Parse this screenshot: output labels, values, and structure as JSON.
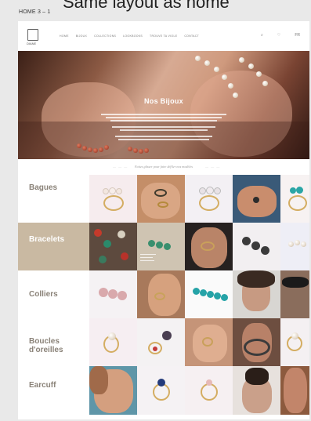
{
  "top_note": "Same layout as home",
  "frame_label": "HOME 3 – 1",
  "brand": {
    "logo_text": "DIANE"
  },
  "nav": [
    "HOME",
    "BIJOUX",
    "COLLECTIONS",
    "LOOKBOOKS",
    "TROUVE TA VIOLE",
    "CONTACT"
  ],
  "header_icons": [
    "⌕",
    "♡",
    "FR"
  ],
  "hero": {
    "title": "Nos Bijoux"
  },
  "strip": {
    "text": "Faites glisser pour faire défiler nos modèles",
    "dots": "— — —"
  },
  "categories": [
    {
      "label": "Bagues",
      "active": false
    },
    {
      "label": "Bracelets",
      "active": true
    },
    {
      "label": "Colliers",
      "active": false
    },
    {
      "label": "Boucles d'oreilles",
      "active": false
    },
    {
      "label": "Earcuff",
      "active": false
    }
  ],
  "colors": {
    "accent": "#c9b9a2",
    "label": "#8a8278",
    "gold": "#d4ad62",
    "turquoise": "#2ba6a6"
  }
}
